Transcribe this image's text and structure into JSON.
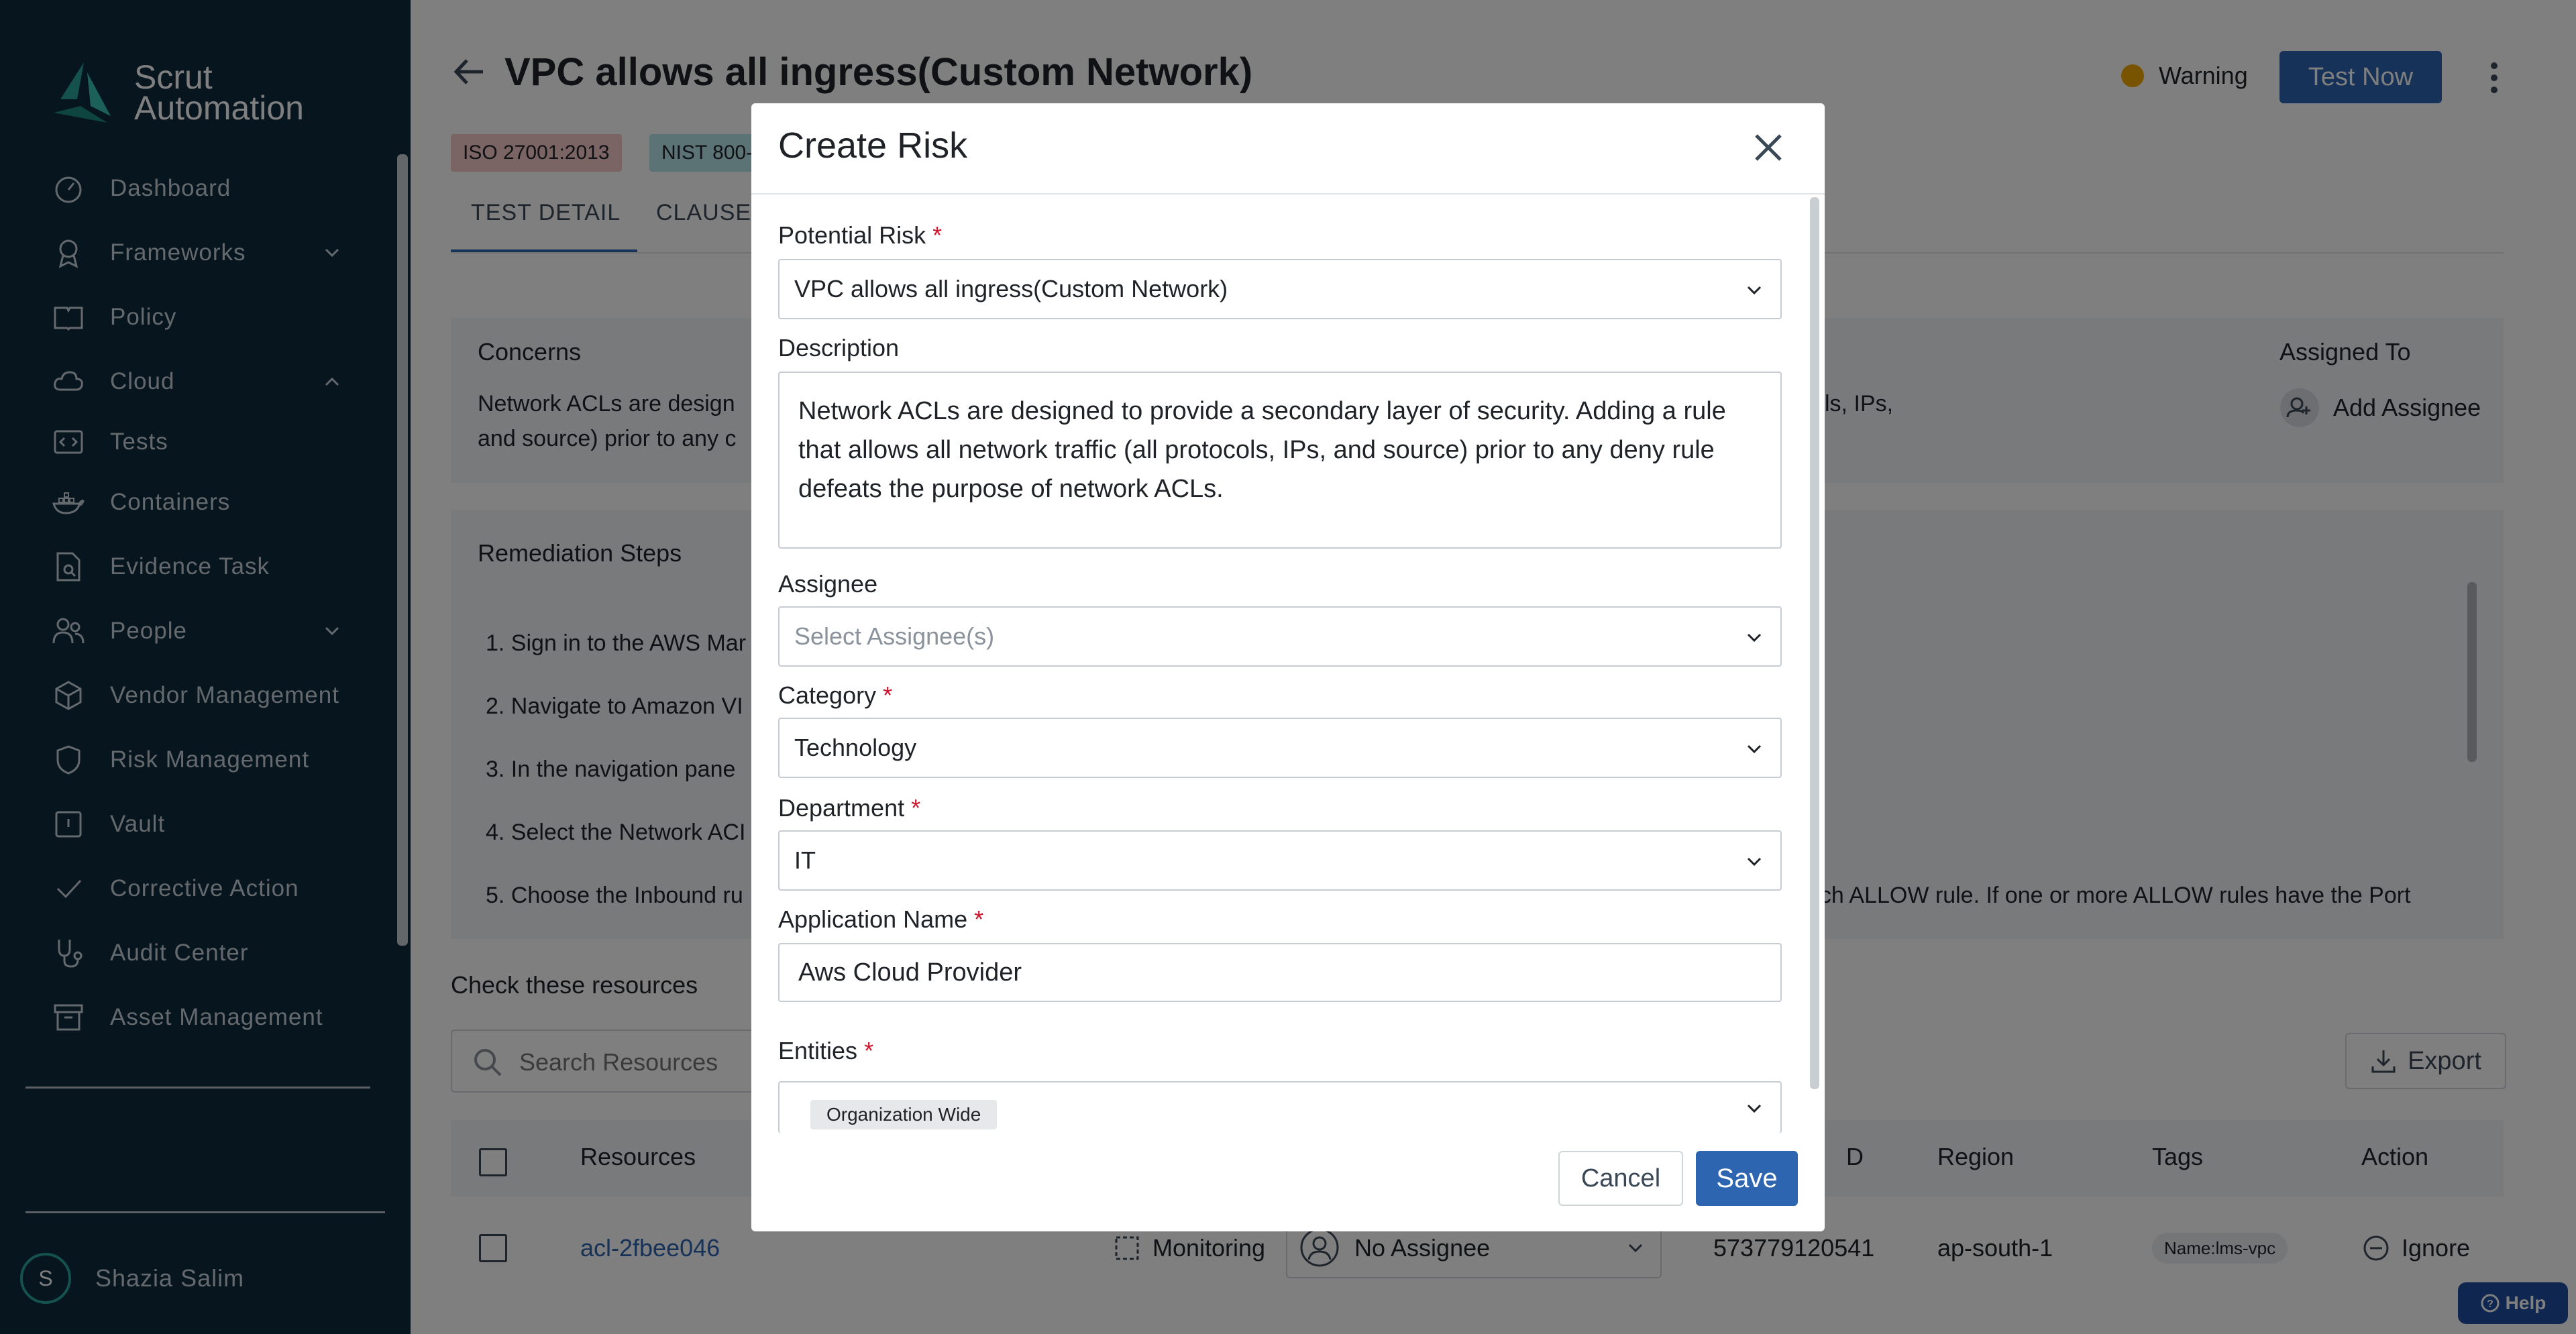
{
  "sidebar": {
    "logo_line1": "Scrut",
    "logo_line2": "Automation",
    "items": [
      {
        "label": "Dashboard",
        "icon": "dashboard-icon"
      },
      {
        "label": "Frameworks",
        "icon": "award-icon",
        "expand": "chevron-down"
      },
      {
        "label": "Policy",
        "icon": "book-icon"
      },
      {
        "label": "Cloud",
        "icon": "cloud-icon",
        "expand": "chevron-up"
      },
      {
        "label": "Tests",
        "icon": "code-icon"
      },
      {
        "label": "Containers",
        "icon": "docker-icon"
      },
      {
        "label": "Evidence Task",
        "icon": "file-search-icon"
      },
      {
        "label": "People",
        "icon": "people-icon",
        "expand": "chevron-down"
      },
      {
        "label": "Vendor Management",
        "icon": "package-icon"
      },
      {
        "label": "Risk Management",
        "icon": "shield-icon"
      },
      {
        "label": "Vault",
        "icon": "vault-icon"
      },
      {
        "label": "Corrective Action",
        "icon": "check-icon"
      },
      {
        "label": "Audit Center",
        "icon": "stethoscope-icon"
      },
      {
        "label": "Asset Management",
        "icon": "archive-icon"
      }
    ],
    "user": {
      "initial": "S",
      "name": "Shazia Salim"
    }
  },
  "header": {
    "title": "VPC allows all ingress(Custom Network)",
    "status": "Warning",
    "test_now": "Test Now",
    "chips": [
      "ISO 27001:2013",
      "NIST 800-"
    ],
    "tabs": [
      "TEST DETAIL",
      "CLAUSES"
    ]
  },
  "concerns": {
    "title": "Concerns",
    "line1": "Network ACLs are design",
    "line2": "and source) prior to any c",
    "right_fragment": "ls, IPs,",
    "assigned_to_label": "Assigned To",
    "add_assignee": "Add Assignee"
  },
  "remediation": {
    "title": "Remediation Steps",
    "steps": [
      "1. Sign in to the AWS Mar",
      "2. Navigate to Amazon VI",
      "3. In the navigation pane",
      "4. Select the Network ACI",
      "5. Choose the Inbound ru"
    ],
    "step5_tail": "ach ALLOW rule. If one or more ALLOW rules have the Port"
  },
  "resources": {
    "title": "Check these resources",
    "search_placeholder": "Search Resources",
    "export": "Export",
    "columns": [
      "Resources",
      "D",
      "Region",
      "Tags",
      "Action"
    ],
    "row": {
      "resource": "acl-2fbee046",
      "status": "Monitoring",
      "assignee": "No Assignee",
      "account_id": "573779120541",
      "region": "ap-south-1",
      "tag": "Name:lms-vpc",
      "action": "Ignore"
    }
  },
  "help": "Help",
  "modal": {
    "title": "Create Risk",
    "potential_risk_label": "Potential Risk",
    "potential_risk_value": "VPC allows all ingress(Custom Network)",
    "description_label": "Description",
    "description_value": "Network ACLs are designed to provide a secondary layer of security. Adding a rule that allows all network traffic (all protocols, IPs, and source) prior to any deny rule defeats the purpose of network ACLs.",
    "assignee_label": "Assignee",
    "assignee_placeholder": "Select Assignee(s)",
    "category_label": "Category",
    "category_value": "Technology",
    "department_label": "Department",
    "department_value": "IT",
    "application_label": "Application Name",
    "application_value": "Aws Cloud Provider",
    "entities_label": "Entities",
    "entities_value": "Organization Wide",
    "required_mark": "*",
    "cancel": "Cancel",
    "save": "Save"
  },
  "colors": {
    "sidebar_bg": "#0f2a3d",
    "primary": "#2d65b1",
    "warning": "#f2a900",
    "required": "#d0142c"
  }
}
